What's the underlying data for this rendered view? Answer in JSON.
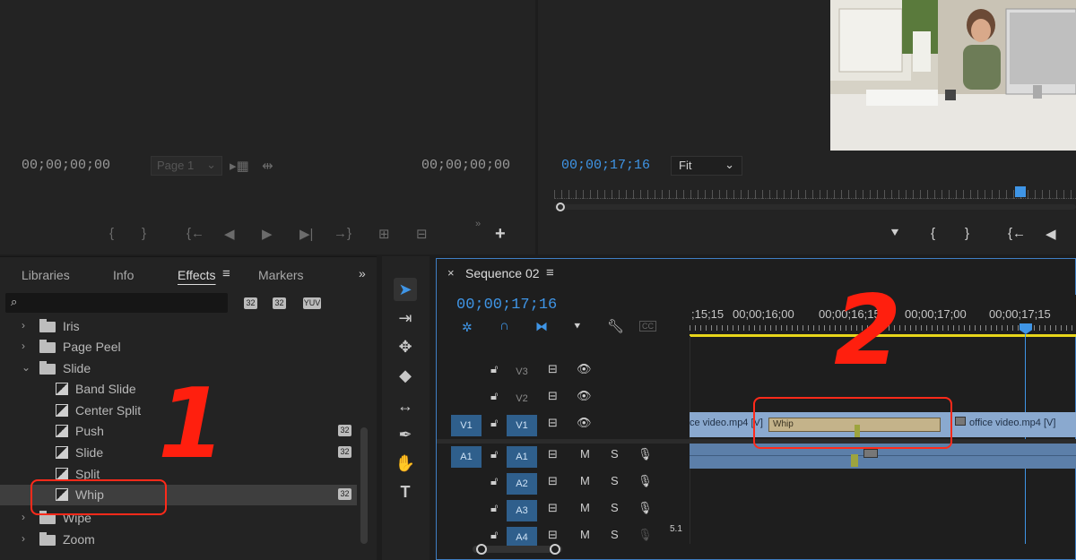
{
  "source_monitor": {
    "timecode_left": "00;00;00;00",
    "timecode_right": "00;00;00;00",
    "page_select": "Page 1",
    "controls": [
      "{",
      "}",
      "{←",
      "◀",
      "▶",
      "▶|",
      "→}",
      "⊞",
      "⊟",
      "+"
    ]
  },
  "program_monitor": {
    "timecode": "00;00;17;16",
    "fit_select": "Fit",
    "controls": [
      "{",
      "}",
      "{←",
      "◀"
    ]
  },
  "effects_panel": {
    "tabs": [
      "Libraries",
      "Info",
      "Effects",
      "Markers"
    ],
    "active_tab": "Effects",
    "search_placeholder": "",
    "badges": [
      "32",
      "32",
      "YUV"
    ],
    "tree": [
      {
        "label": "Iris",
        "type": "folder",
        "expanded": false
      },
      {
        "label": "Page Peel",
        "type": "folder",
        "expanded": false
      },
      {
        "label": "Slide",
        "type": "folder",
        "expanded": true
      },
      {
        "label": "Band Slide",
        "type": "effect"
      },
      {
        "label": "Center Split",
        "type": "effect"
      },
      {
        "label": "Push",
        "type": "effect",
        "badge": "32"
      },
      {
        "label": "Slide",
        "type": "effect",
        "badge": "32"
      },
      {
        "label": "Split",
        "type": "effect"
      },
      {
        "label": "Whip",
        "type": "effect",
        "badge": "32",
        "selected": true
      },
      {
        "label": "Wipe",
        "type": "folder",
        "expanded": false
      },
      {
        "label": "Zoom",
        "type": "folder",
        "expanded": false
      }
    ]
  },
  "timeline": {
    "sequence_name": "Sequence 02",
    "timecode": "00;00;17;16",
    "ruler_labels": [
      ";15;15",
      "00;00;16;00",
      "00;00;16;15",
      "00;00;17;00",
      "00;00;17;15"
    ],
    "video_tracks": [
      {
        "name": "V3",
        "toggle": ""
      },
      {
        "name": "V2",
        "toggle": ""
      },
      {
        "name": "V1",
        "toggle": "V1"
      }
    ],
    "audio_tracks": [
      {
        "name": "A1",
        "toggle": "A1",
        "m": "M",
        "s": "S"
      },
      {
        "name": "A2",
        "toggle": "",
        "m": "M",
        "s": "S"
      },
      {
        "name": "A3",
        "toggle": "",
        "m": "M",
        "s": "S"
      },
      {
        "name": "A4",
        "toggle": "",
        "m": "M",
        "s": "S"
      }
    ],
    "clip_left_label": "ce video.mp4 [V]",
    "clip_right_label": "office video.mp4 [V]",
    "transition_label": "Whip",
    "audio_marker": "5.1"
  },
  "annotations": {
    "step1": "1",
    "step2": "2"
  }
}
